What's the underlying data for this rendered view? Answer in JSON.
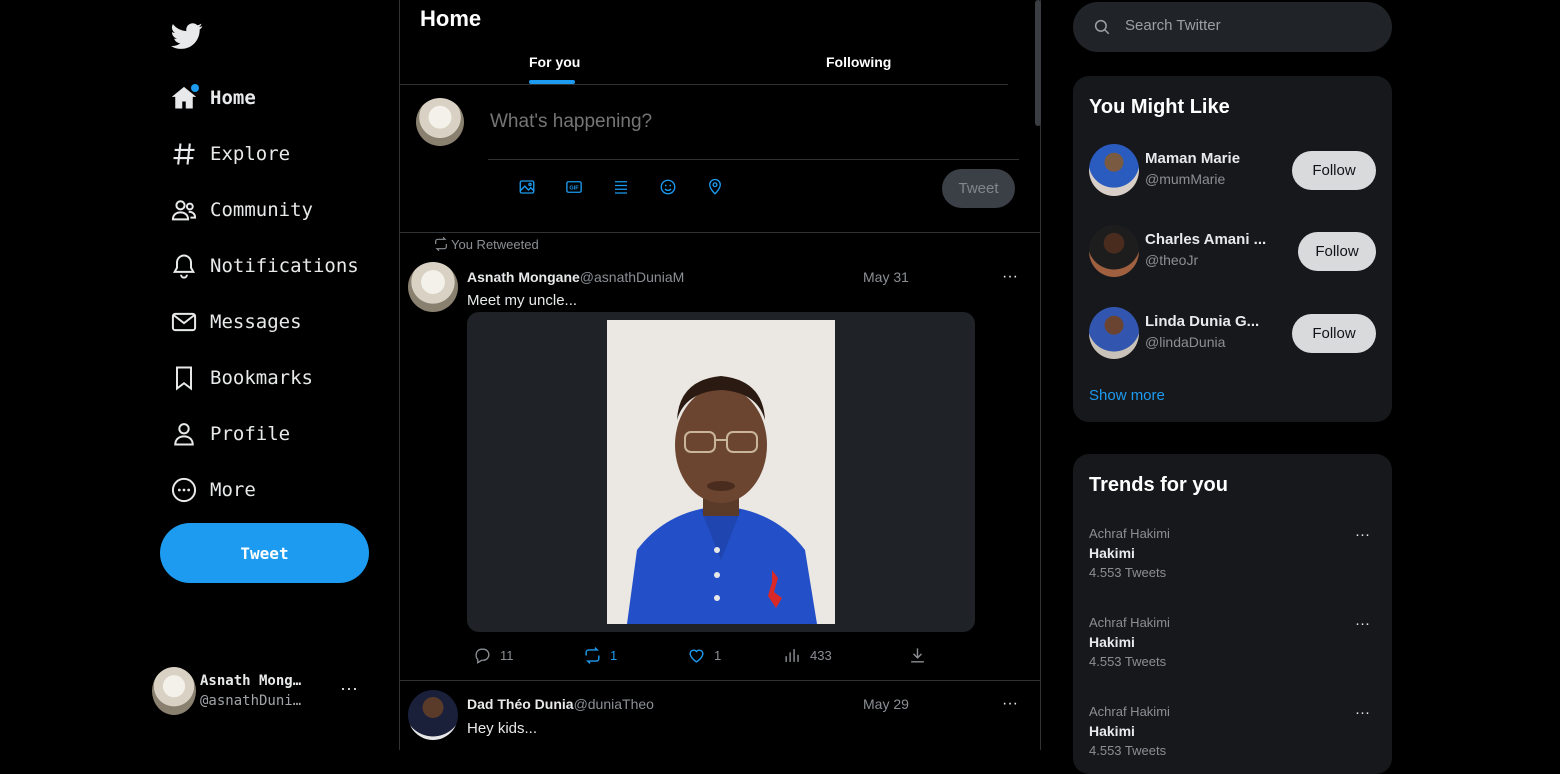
{
  "sidebar": {
    "nav": [
      {
        "label": "Home",
        "icon": "home-icon"
      },
      {
        "label": "Explore",
        "icon": "hashtag-icon"
      },
      {
        "label": "Community",
        "icon": "community-icon"
      },
      {
        "label": "Notifications",
        "icon": "bell-icon"
      },
      {
        "label": "Messages",
        "icon": "envelope-icon"
      },
      {
        "label": "Bookmarks",
        "icon": "bookmark-icon"
      },
      {
        "label": "Profile",
        "icon": "user-icon"
      },
      {
        "label": "More",
        "icon": "more-circle-icon"
      }
    ],
    "tweet_button": "Tweet",
    "account": {
      "name": "Asnath Mong…",
      "handle": "@asnathDuni…",
      "more": "···"
    }
  },
  "main": {
    "title": "Home",
    "tabs": [
      {
        "label": "For you"
      },
      {
        "label": "Following"
      }
    ],
    "composer": {
      "placeholder": "What's happening?",
      "tweet_button": "Tweet"
    },
    "retweet_note": "You Retweeted",
    "posts": [
      {
        "name": "Asnath Mongane",
        "handle": "@asnathDuniaM",
        "date": "May 31",
        "text": "Meet my uncle...",
        "replies": "11",
        "retweets": "1",
        "likes": "1",
        "views": "433"
      },
      {
        "name": "Dad Théo Dunia",
        "handle": "@duniaTheo",
        "date": "May 29",
        "text": "Hey kids..."
      }
    ]
  },
  "right": {
    "search_placeholder": "Search Twitter",
    "suggestions_title": "You Might Like",
    "suggestions": [
      {
        "name": "Maman Marie",
        "handle": "@mumMarie",
        "button": "Follow"
      },
      {
        "name": "Charles Amani ...",
        "handle": "@theoJr",
        "button": "Follow"
      },
      {
        "name": "Linda Dunia G...",
        "handle": "@lindaDunia",
        "button": "Follow"
      }
    ],
    "show_more": "Show more",
    "trends_title": "Trends for you",
    "trends": [
      {
        "context": "Achraf Hakimi",
        "name": "Hakimi",
        "count": "4.553 Tweets"
      },
      {
        "context": "Achraf Hakimi",
        "name": "Hakimi",
        "count": "4.553 Tweets"
      },
      {
        "context": "Achraf Hakimi",
        "name": "Hakimi",
        "count": "4.553 Tweets"
      }
    ]
  },
  "colors": {
    "accent": "#1d9bf0",
    "background": "#000000",
    "card": "#16181c"
  }
}
